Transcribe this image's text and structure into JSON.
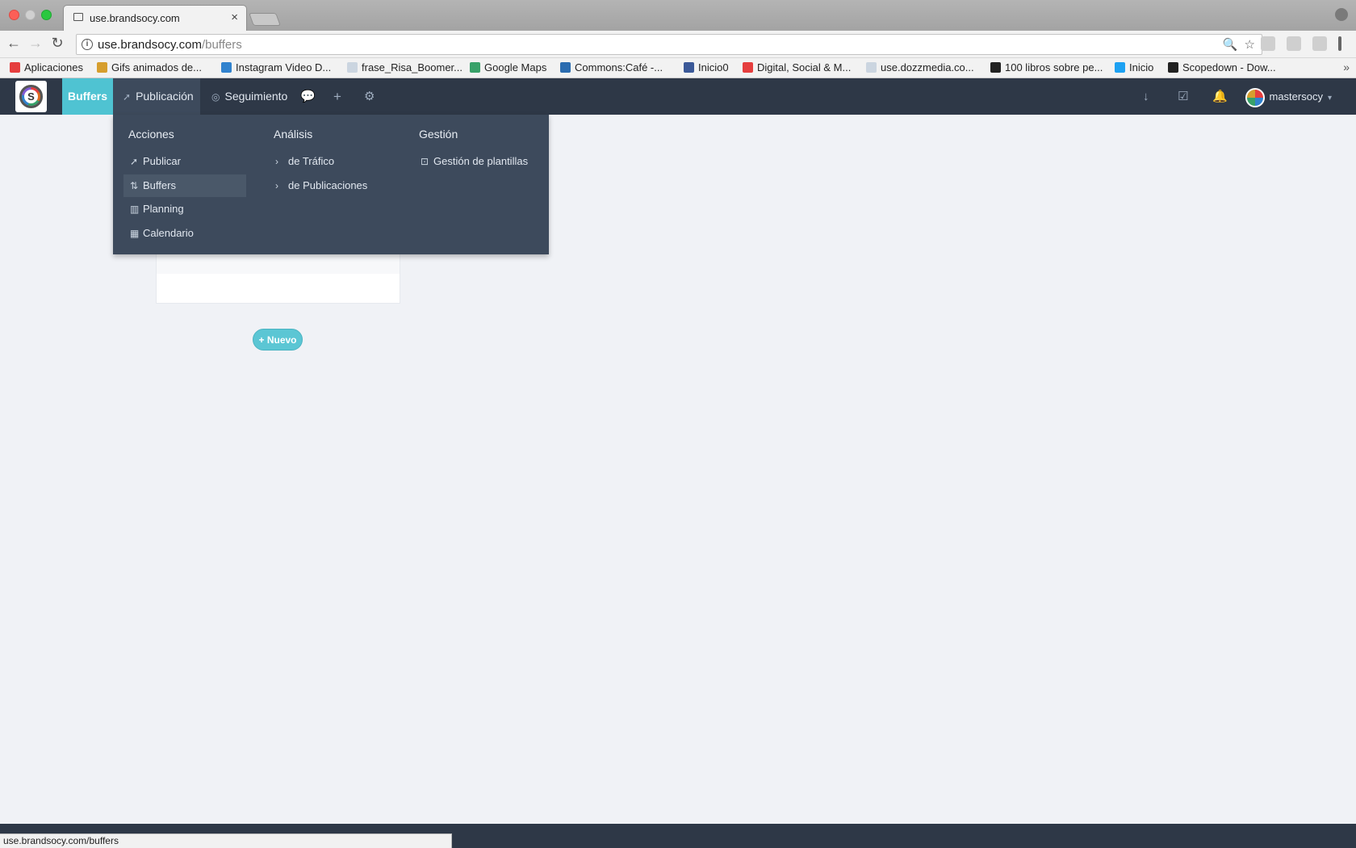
{
  "browser": {
    "tab_title": "use.brandsocy.com",
    "tab_close": "×",
    "url_host": "use.brandsocy.com",
    "url_path": "/buffers",
    "status_url": "use.brandsocy.com/buffers",
    "info_glyph": "i",
    "bookmarks": [
      {
        "label": "Aplicaciones",
        "color": "#e53e3e"
      },
      {
        "label": "Gifs animados de...",
        "color": "#d69e2e"
      },
      {
        "label": "Instagram Video D...",
        "color": "#3182ce"
      },
      {
        "label": "frase_Risa_Boomer...",
        "color": "#cbd5e0"
      },
      {
        "label": "Google Maps",
        "color": "#38a169"
      },
      {
        "label": "Commons:Café -...",
        "color": "#2b6cb0"
      },
      {
        "label": "Inicio0",
        "color": "#3b5998"
      },
      {
        "label": "Digital, Social & M...",
        "color": "#e53e3e"
      },
      {
        "label": "use.dozzmedia.co...",
        "color": "#cbd5e0"
      },
      {
        "label": "100 libros sobre pe...",
        "color": "#222222"
      },
      {
        "label": "Inicio",
        "color": "#1da1f2"
      },
      {
        "label": "Scopedown - Dow...",
        "color": "#222222"
      }
    ]
  },
  "navbar": {
    "items": [
      {
        "label": "Buffers"
      },
      {
        "label": "Publicación",
        "icon": "rocket-icon"
      },
      {
        "label": "Seguimiento",
        "icon": "target-icon"
      }
    ],
    "icons": [
      "comments-icon",
      "plus-icon",
      "gear-icon"
    ],
    "right_icons": [
      "download-icon",
      "check-square-icon",
      "bell-icon"
    ],
    "user": "mastersocy"
  },
  "dropdown": {
    "columns": [
      {
        "title": "Acciones",
        "items": [
          {
            "label": "Publicar",
            "icon": "rocket-icon"
          },
          {
            "label": "Buffers",
            "icon": "sort-icon"
          },
          {
            "label": "Planning",
            "icon": "map-icon"
          },
          {
            "label": "Calendario",
            "icon": "calendar-icon"
          }
        ]
      },
      {
        "title": "Análisis",
        "items": [
          {
            "label": "de Tráfico",
            "icon": "chevron-right-icon"
          },
          {
            "label": "de Publicaciones",
            "icon": "chevron-right-icon"
          }
        ]
      },
      {
        "title": "Gestión",
        "items": [
          {
            "label": "Gestión de plantillas",
            "icon": "template-icon"
          }
        ]
      }
    ]
  },
  "main": {
    "new_button": "+ Nuevo"
  },
  "colors": {
    "navbar_bg": "#2e3847",
    "active_tab": "#4fc3d2",
    "dropdown_bg": "#3d4a5c",
    "page_bg": "#f0f2f6",
    "new_button": "#5bc6d4"
  }
}
